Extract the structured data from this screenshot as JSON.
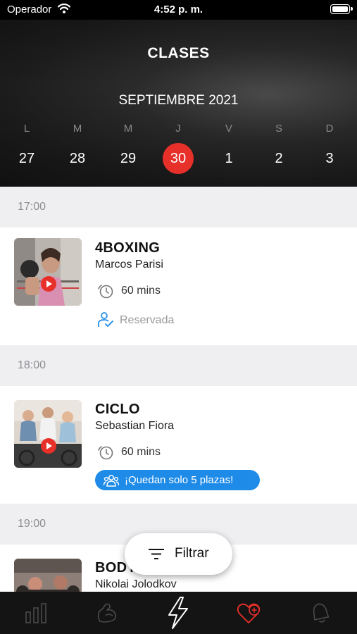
{
  "status_bar": {
    "carrier": "Operador",
    "time": "4:52 p. m."
  },
  "header": {
    "title": "CLASES",
    "month": "SEPTIEMBRE 2021",
    "weekdays": [
      "L",
      "M",
      "M",
      "J",
      "V",
      "S",
      "D"
    ],
    "days": [
      "27",
      "28",
      "29",
      "30",
      "1",
      "2",
      "3"
    ],
    "selected_day": "30",
    "accent_color": "#e8302a"
  },
  "slots": [
    {
      "time": "17:00",
      "class_name": "4BOXING",
      "instructor": "Marcos Parisi",
      "duration": "60 mins",
      "status": "Reservada",
      "thumbnail": "boxing-photo"
    },
    {
      "time": "18:00",
      "class_name": "CICLO",
      "instructor": "Sebastian Fiora",
      "duration": "60 mins",
      "availability": "¡Quedan solo 5 plazas!",
      "thumbnail": "cycling-photo"
    },
    {
      "time": "19:00",
      "class_name": "BODY",
      "instructor": "Nikolai Jolodkov",
      "thumbnail": "gym-photo"
    }
  ],
  "filter": {
    "label": "Filtrar",
    "icon": "filter-lines-icon"
  },
  "tab_bar": [
    {
      "icon": "bar-chart-icon",
      "active": false
    },
    {
      "icon": "muscle-icon",
      "active": false
    },
    {
      "icon": "lightning-icon",
      "active": true
    },
    {
      "icon": "heart-add-icon",
      "active": false,
      "color": "#e8302a"
    },
    {
      "icon": "bell-icon",
      "active": false
    }
  ],
  "colors": {
    "accent": "#e8302a",
    "badge_blue": "#1e8be8",
    "booked_blue": "#1e8be8"
  }
}
